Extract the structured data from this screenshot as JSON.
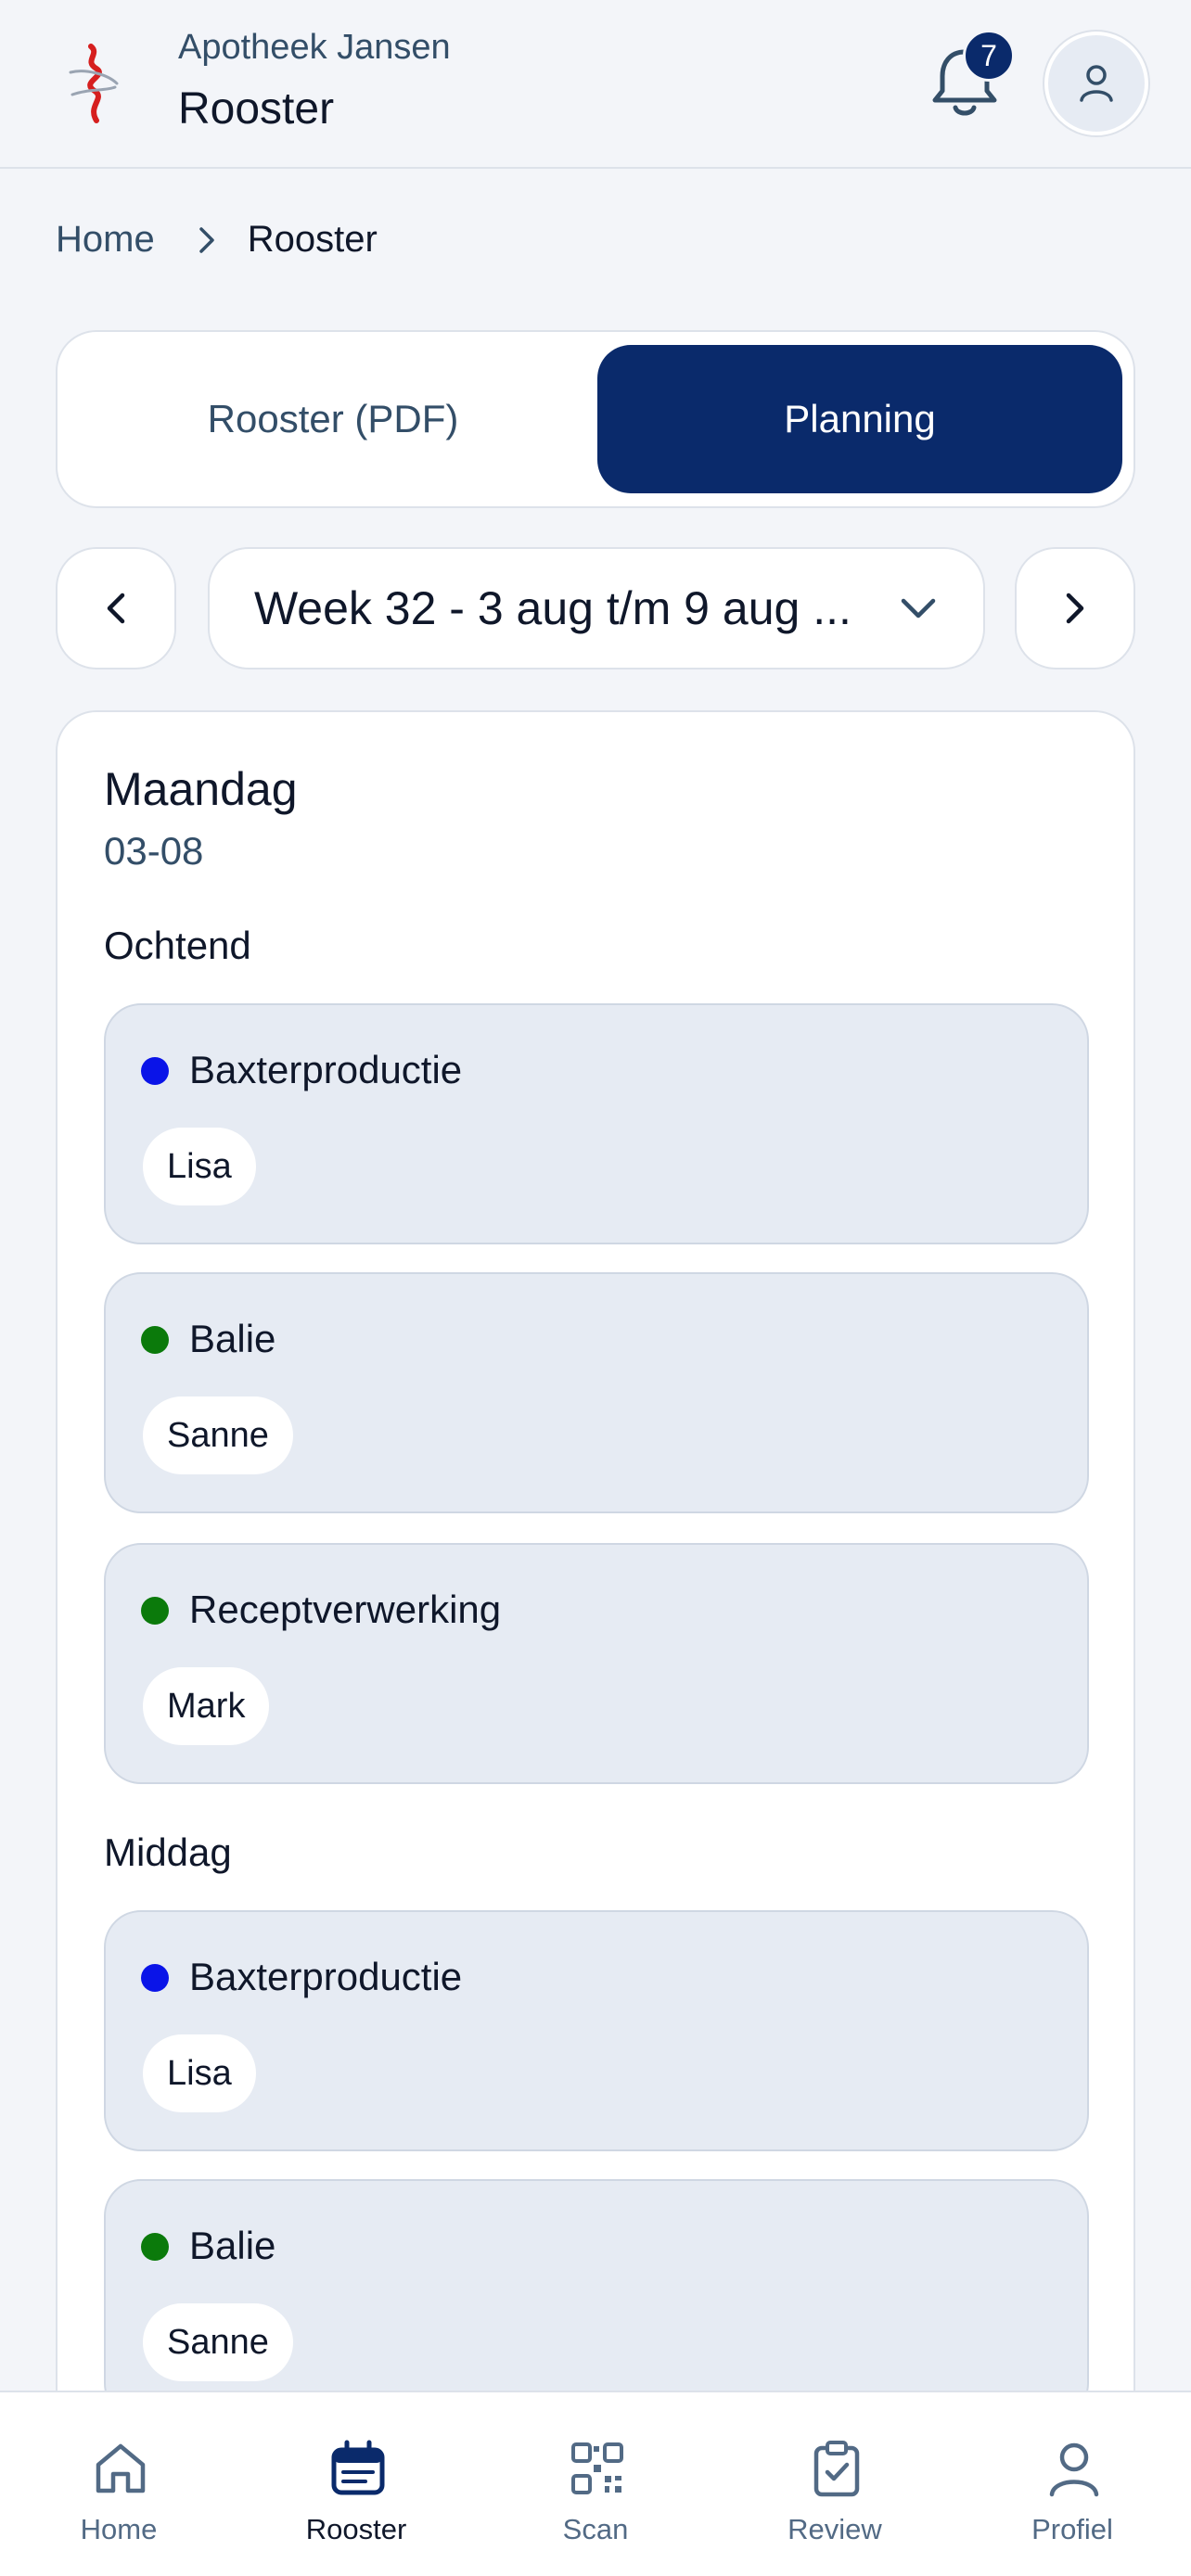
{
  "header": {
    "subtitle": "Apotheek Jansen",
    "title": "Rooster",
    "notification_count": "7"
  },
  "breadcrumb": {
    "home": "Home",
    "current": "Rooster"
  },
  "view_toggle": {
    "options": [
      "Rooster (PDF)",
      "Planning"
    ],
    "active": "Planning"
  },
  "week_selector": {
    "selected": "Week 32 - 3 aug t/m 9 aug ..."
  },
  "day": {
    "name": "Maandag",
    "date": "03-08",
    "periods": [
      {
        "label": "Ochtend",
        "tasks": [
          {
            "name": "Baxterproductie",
            "dot_color": "#0a14e8",
            "person": "Lisa"
          },
          {
            "name": "Balie",
            "dot_color": "#0b7a0b",
            "person": "Sanne"
          },
          {
            "name": "Receptverwerking",
            "dot_color": "#0b7a0b",
            "person": "Mark"
          }
        ]
      },
      {
        "label": "Middag",
        "tasks": [
          {
            "name": "Baxterproductie",
            "dot_color": "#0a14e8",
            "person": "Lisa"
          },
          {
            "name": "Balie",
            "dot_color": "#0b7a0b",
            "person": "Sanne"
          }
        ]
      }
    ]
  },
  "bottom_nav": {
    "items": [
      {
        "label": "Home",
        "icon": "home-icon"
      },
      {
        "label": "Rooster",
        "icon": "calendar-icon"
      },
      {
        "label": "Scan",
        "icon": "qr-code-icon"
      },
      {
        "label": "Review",
        "icon": "clipboard-check-icon"
      },
      {
        "label": "Profiel",
        "icon": "user-icon"
      }
    ],
    "active": "Rooster"
  },
  "colors": {
    "accent": "#0a2a6b",
    "background": "#f3f5f9",
    "task_background": "#e6ebf3"
  }
}
